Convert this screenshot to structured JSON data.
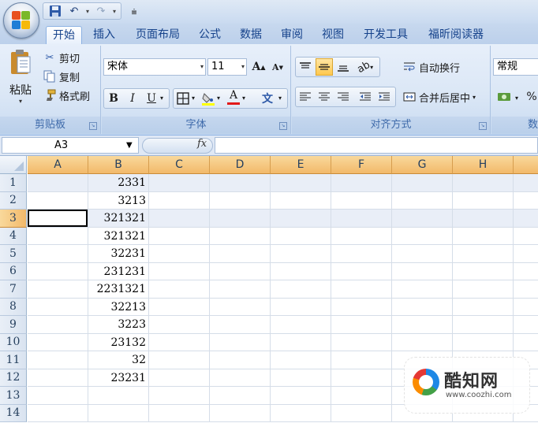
{
  "quick_access": {
    "save_icon": "save-icon",
    "undo_icon": "undo-icon",
    "redo_icon": "redo-icon",
    "more_icon": "customize-qat-icon"
  },
  "tabs": [
    "开始",
    "插入",
    "页面布局",
    "公式",
    "数据",
    "审阅",
    "视图",
    "开发工具",
    "福昕阅读器"
  ],
  "active_tab": "开始",
  "ribbon": {
    "clipboard": {
      "label": "剪贴板",
      "paste": "粘贴",
      "cut": "剪切",
      "copy": "复制",
      "format_painter": "格式刷"
    },
    "font": {
      "label": "字体",
      "font_name": "宋体",
      "font_size": "11",
      "bold": "B",
      "italic": "I",
      "underline": "U",
      "grow": "A",
      "shrink": "A",
      "font_color": "A",
      "phonetic": "文"
    },
    "alignment": {
      "label": "对齐方式",
      "wrap_text": "自动换行",
      "merge_center": "合并后居中"
    },
    "number": {
      "label": "数",
      "format": "常规",
      "percent": "%"
    }
  },
  "formula_bar": {
    "name_box": "A3",
    "fx": "fx",
    "formula": ""
  },
  "columns": [
    "A",
    "B",
    "C",
    "D",
    "E",
    "F",
    "G",
    "H"
  ],
  "rows": [
    {
      "num": "1",
      "b": "2331"
    },
    {
      "num": "2",
      "b": "3213"
    },
    {
      "num": "3",
      "b": "321321"
    },
    {
      "num": "4",
      "b": "321321"
    },
    {
      "num": "5",
      "b": "32231"
    },
    {
      "num": "6",
      "b": "231231"
    },
    {
      "num": "7",
      "b": "2231321"
    },
    {
      "num": "8",
      "b": "32213"
    },
    {
      "num": "9",
      "b": "3223"
    },
    {
      "num": "10",
      "b": "23132"
    },
    {
      "num": "11",
      "b": "32"
    },
    {
      "num": "12",
      "b": "23231"
    },
    {
      "num": "13",
      "b": ""
    },
    {
      "num": "14",
      "b": ""
    }
  ],
  "watermark": {
    "title": "酷知网",
    "url": "www.coozhi.com"
  }
}
